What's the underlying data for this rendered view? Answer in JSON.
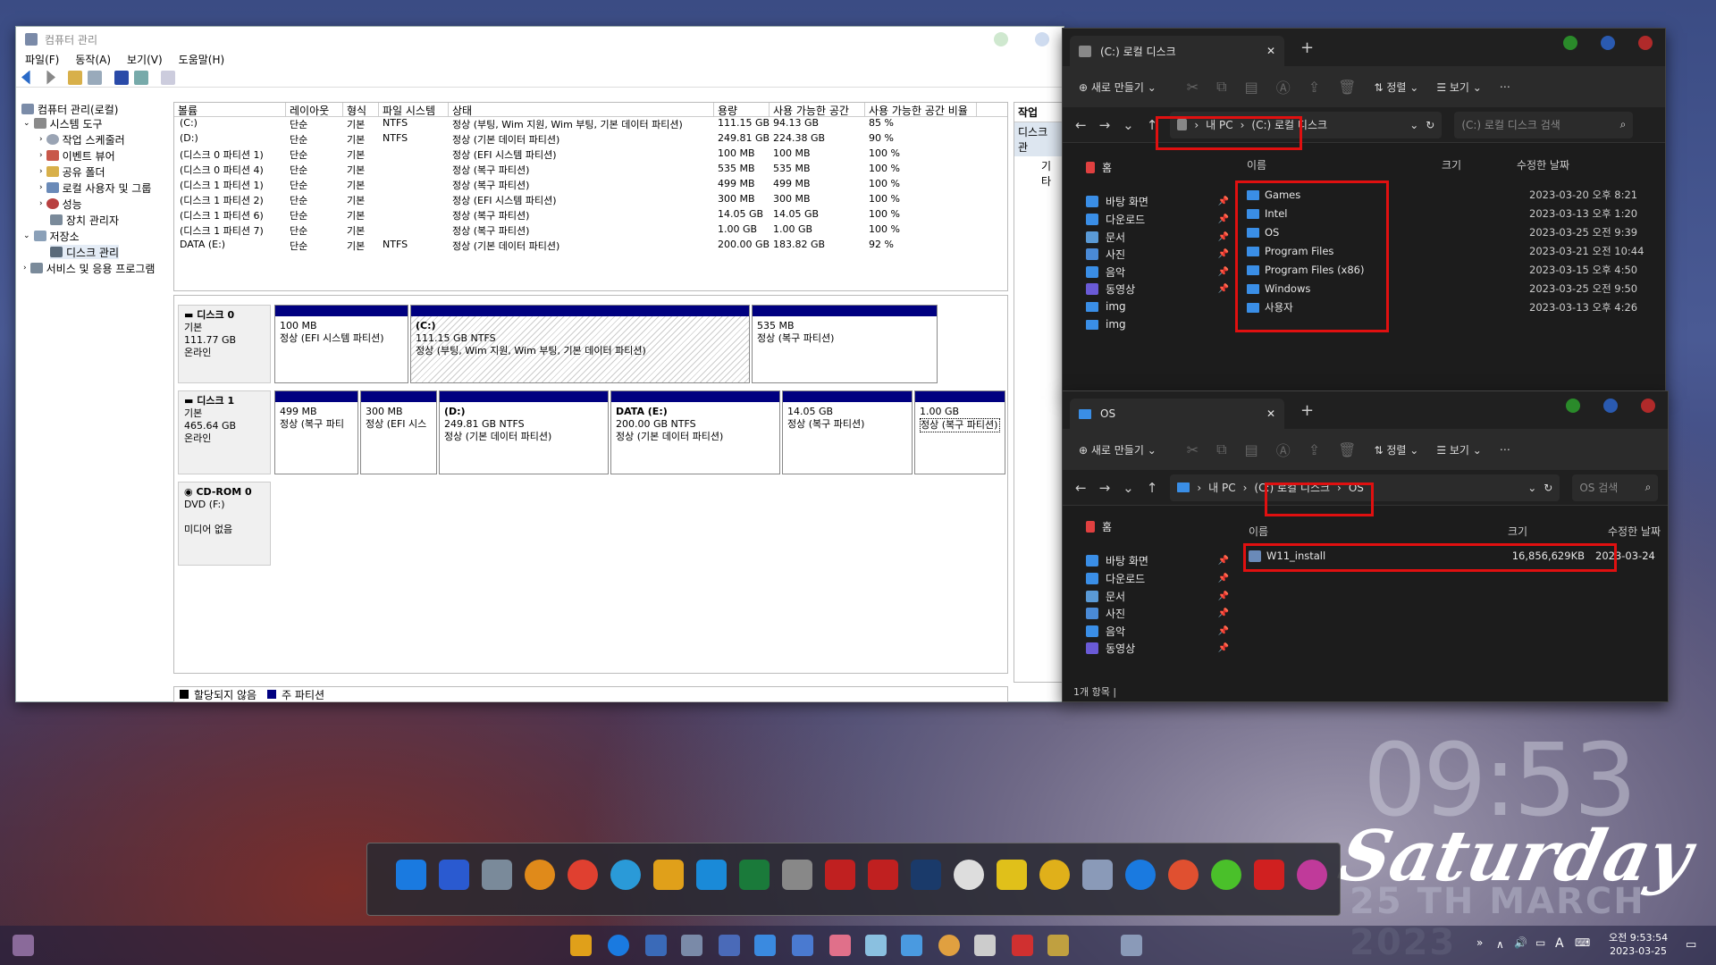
{
  "cm": {
    "title": "컴퓨터 관리",
    "menu": [
      "파일(F)",
      "동작(A)",
      "보기(V)",
      "도움말(H)"
    ],
    "tree": [
      {
        "label": "컴퓨터 관리(로컬)",
        "level": 0
      },
      {
        "label": "시스템 도구",
        "level": 1
      },
      {
        "label": "작업 스케줄러",
        "level": 2
      },
      {
        "label": "이벤트 뷰어",
        "level": 2
      },
      {
        "label": "공유 폴더",
        "level": 2
      },
      {
        "label": "로컬 사용자 및 그룹",
        "level": 2
      },
      {
        "label": "성능",
        "level": 2
      },
      {
        "label": "장치 관리자",
        "level": 2
      },
      {
        "label": "저장소",
        "level": 1
      },
      {
        "label": "디스크 관리",
        "level": 2
      },
      {
        "label": "서비스 및 응용 프로그램",
        "level": 1
      }
    ],
    "columns": [
      "볼륨",
      "레이아웃",
      "형식",
      "파일 시스템",
      "상태",
      "용량",
      "사용 가능한 공간",
      "사용 가능한 공간 비율"
    ],
    "volumes": [
      [
        "(C:)",
        "단순",
        "기본",
        "NTFS",
        "정상 (부팅, Wim 지원, Wim 부팅, 기본 데이터 파티션)",
        "111.15 GB",
        "94.13 GB",
        "85 %"
      ],
      [
        "(D:)",
        "단순",
        "기본",
        "NTFS",
        "정상 (기본 데이터 파티션)",
        "249.81 GB",
        "224.38 GB",
        "90 %"
      ],
      [
        "(디스크 0 파티션 1)",
        "단순",
        "기본",
        "",
        "정상 (EFI 시스템 파티션)",
        "100 MB",
        "100 MB",
        "100 %"
      ],
      [
        "(디스크 0 파티션 4)",
        "단순",
        "기본",
        "",
        "정상 (복구 파티션)",
        "535 MB",
        "535 MB",
        "100 %"
      ],
      [
        "(디스크 1 파티션 1)",
        "단순",
        "기본",
        "",
        "정상 (복구 파티션)",
        "499 MB",
        "499 MB",
        "100 %"
      ],
      [
        "(디스크 1 파티션 2)",
        "단순",
        "기본",
        "",
        "정상 (EFI 시스템 파티션)",
        "300 MB",
        "300 MB",
        "100 %"
      ],
      [
        "(디스크 1 파티션 6)",
        "단순",
        "기본",
        "",
        "정상 (복구 파티션)",
        "14.05 GB",
        "14.05 GB",
        "100 %"
      ],
      [
        "(디스크 1 파티션 7)",
        "단순",
        "기본",
        "",
        "정상 (복구 파티션)",
        "1.00 GB",
        "1.00 GB",
        "100 %"
      ],
      [
        "DATA (E:)",
        "단순",
        "기본",
        "NTFS",
        "정상 (기본 데이터 파티션)",
        "200.00 GB",
        "183.82 GB",
        "92 %"
      ]
    ],
    "disks": [
      {
        "name": "디스크 0",
        "type": "기본",
        "size": "111.77 GB",
        "state": "온라인",
        "parts": [
          {
            "l1": "",
            "l2": "100 MB",
            "l3": "정상 (EFI 시스템 파티션)"
          },
          {
            "l1": "(C:)",
            "l2": "111.15 GB NTFS",
            "l3": "정상 (부팅, Wim 지원, Wim 부팅, 기본 데이터 파티션)"
          },
          {
            "l1": "",
            "l2": "535 MB",
            "l3": "정상 (복구 파티션)"
          }
        ]
      },
      {
        "name": "디스크 1",
        "type": "기본",
        "size": "465.64 GB",
        "state": "온라인",
        "parts": [
          {
            "l1": "",
            "l2": "499 MB",
            "l3": "정상 (복구 파티"
          },
          {
            "l1": "",
            "l2": "300 MB",
            "l3": "정상 (EFI 시스"
          },
          {
            "l1": "(D:)",
            "l2": "249.81 GB NTFS",
            "l3": "정상 (기본 데이터 파티션)"
          },
          {
            "l1": "DATA  (E:)",
            "l2": "200.00 GB NTFS",
            "l3": "정상 (기본 데이터 파티션)"
          },
          {
            "l1": "",
            "l2": "14.05 GB",
            "l3": "정상 (복구 파티션)"
          },
          {
            "l1": "",
            "l2": "1.00 GB",
            "l3": "정상 (복구 파티션)"
          }
        ]
      },
      {
        "name": "CD-ROM 0",
        "type": "DVD (F:)",
        "size": "",
        "state": "미디어 없음",
        "parts": []
      }
    ],
    "legend": [
      "할당되지 않음",
      "주 파티션"
    ],
    "actions_header": "작업",
    "actions_item": "디스크 관",
    "actions_sub": "기타"
  },
  "ex1": {
    "tab": "(C:) 로컬 디스크",
    "new_label": "새로 만들기",
    "sort_label": "정렬",
    "view_label": "보기",
    "crumbs": [
      "내 PC",
      "(C:) 로컬 디스크"
    ],
    "search": "(C:) 로컬 디스크 검색",
    "sidebar": [
      {
        "label": "홈"
      },
      {
        "label": "바탕 화면"
      },
      {
        "label": "다운로드"
      },
      {
        "label": "문서"
      },
      {
        "label": "사진"
      },
      {
        "label": "음악"
      },
      {
        "label": "동영상"
      },
      {
        "label": "img"
      },
      {
        "label": "img"
      }
    ],
    "cols": [
      "이름",
      "크기",
      "수정한 날짜"
    ],
    "rows": [
      {
        "name": "Games",
        "date": "2023-03-20 오후 8:21"
      },
      {
        "name": "Intel",
        "date": "2023-03-13 오후 1:20"
      },
      {
        "name": "OS",
        "date": "2023-03-25 오전 9:39"
      },
      {
        "name": "Program Files",
        "date": "2023-03-21 오전 10:44"
      },
      {
        "name": "Program Files (x86)",
        "date": "2023-03-15 오후 4:50"
      },
      {
        "name": "Windows",
        "date": "2023-03-25 오전 9:50"
      },
      {
        "name": "사용자",
        "date": "2023-03-13 오후 4:26"
      }
    ]
  },
  "ex2": {
    "tab": "OS",
    "new_label": "새로 만들기",
    "sort_label": "정렬",
    "view_label": "보기",
    "crumbs": [
      "내 PC",
      "(C:) 로컬 디스크",
      "OS"
    ],
    "search": "OS 검색",
    "sidebar": [
      {
        "label": "홈"
      },
      {
        "label": "바탕 화면"
      },
      {
        "label": "다운로드"
      },
      {
        "label": "문서"
      },
      {
        "label": "사진"
      },
      {
        "label": "음악"
      },
      {
        "label": "동영상"
      }
    ],
    "cols": [
      "이름",
      "크기",
      "수정한 날짜"
    ],
    "file": {
      "name": "W11_install",
      "size": "16,856,629KB",
      "date": "2023-03-24"
    },
    "status": "1개 항목"
  },
  "desktop": {
    "clock": "09:53",
    "day": "Saturday",
    "date": "25 TH MARCH 2023"
  },
  "tray": {
    "time": "오전 9:53:54",
    "date": "2023-03-25"
  }
}
